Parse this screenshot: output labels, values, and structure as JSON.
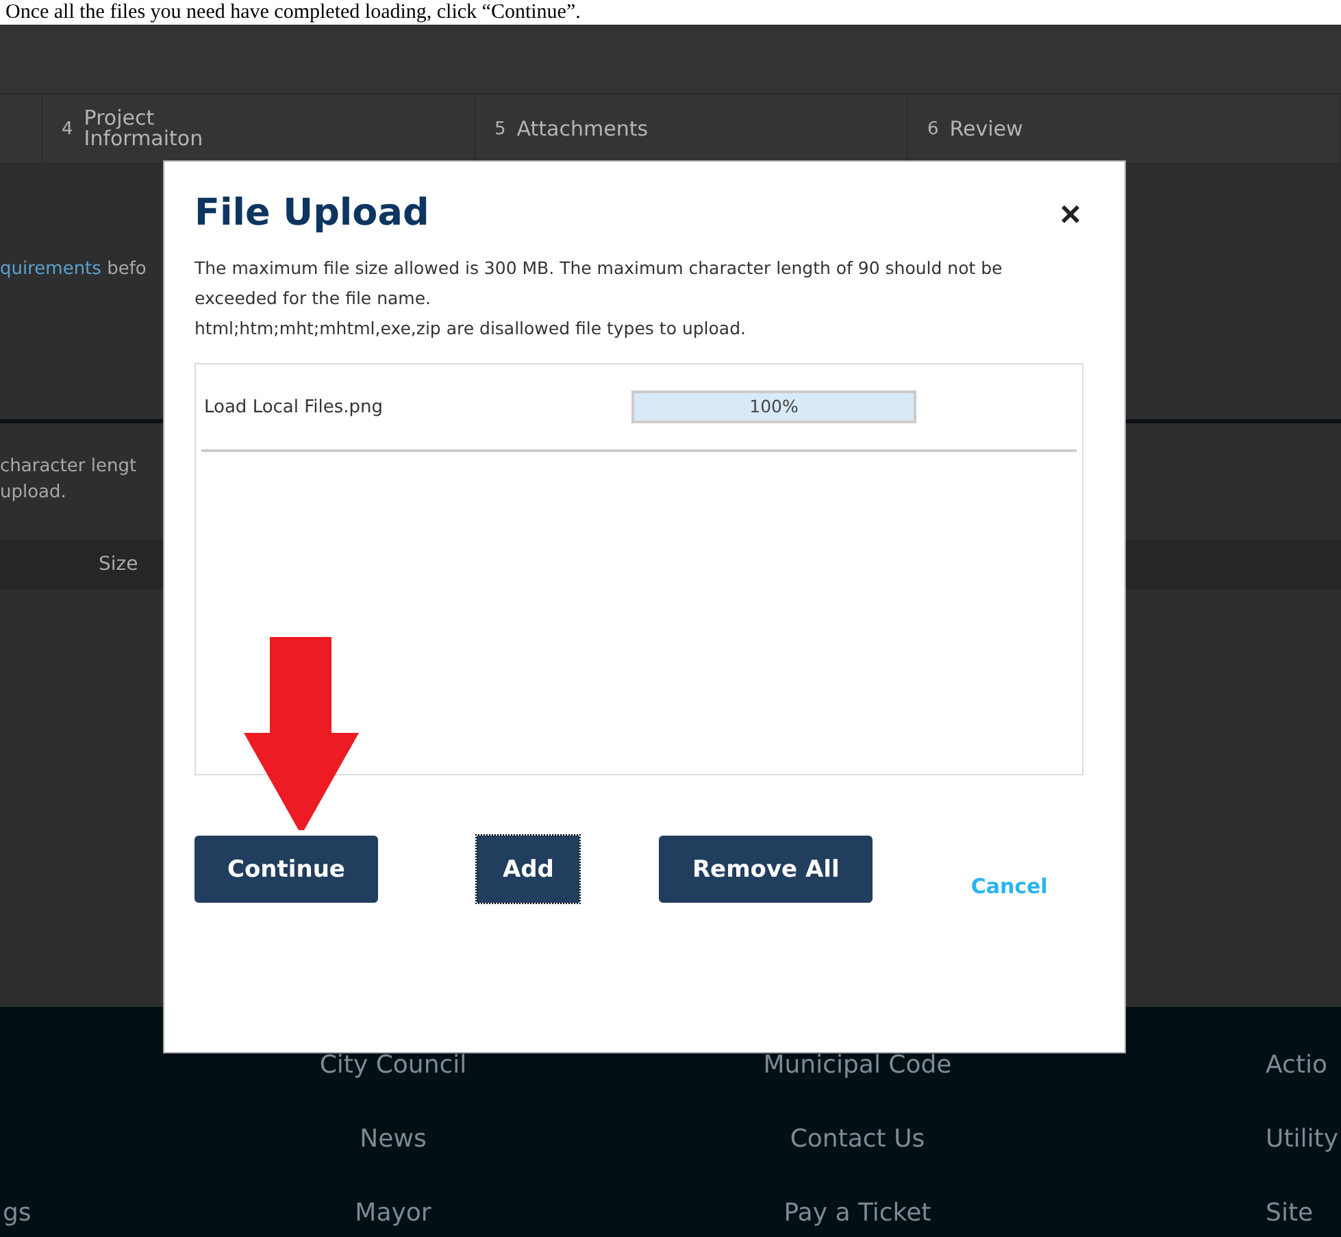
{
  "caption": "Once all the files you need have completed loading, click “Continue”.",
  "steps": [
    {
      "number": "4",
      "label": "Project Informaiton"
    },
    {
      "number": "5",
      "label": "Attachments"
    },
    {
      "number": "6",
      "label": "Review"
    }
  ],
  "background": {
    "link": "quirements",
    "link_tail": "befo",
    "note_lines": [
      "character lengt",
      "upload."
    ],
    "table_header": "Size"
  },
  "footer": {
    "columns": [
      [
        "",
        "",
        "gs"
      ],
      [
        "City Council",
        "News",
        "Mayor"
      ],
      [
        "Municipal Code",
        "Contact Us",
        "Pay a Ticket"
      ],
      [
        "Actio",
        "Utility",
        "Site"
      ]
    ]
  },
  "dialog": {
    "title": "File Upload",
    "close": "×",
    "notes": [
      "The maximum file size allowed is 300 MB. The maximum character length of 90 should not be exceeded for the file name.",
      "html;htm;mht;mhtml,exe,zip are disallowed file types to upload."
    ],
    "files": [
      {
        "name": "Load Local Files.png",
        "level": 1,
        "reading": "100%"
      }
    ],
    "buttons": [
      {
        "label": "Continue",
        "kind": "primary",
        "focused": false
      },
      {
        "label": "Add",
        "kind": "primary",
        "focused": true
      },
      {
        "label": "Remove All",
        "kind": "primary",
        "focused": false
      },
      {
        "label": "Cancel",
        "kind": "link",
        "focused": false
      }
    ]
  }
}
